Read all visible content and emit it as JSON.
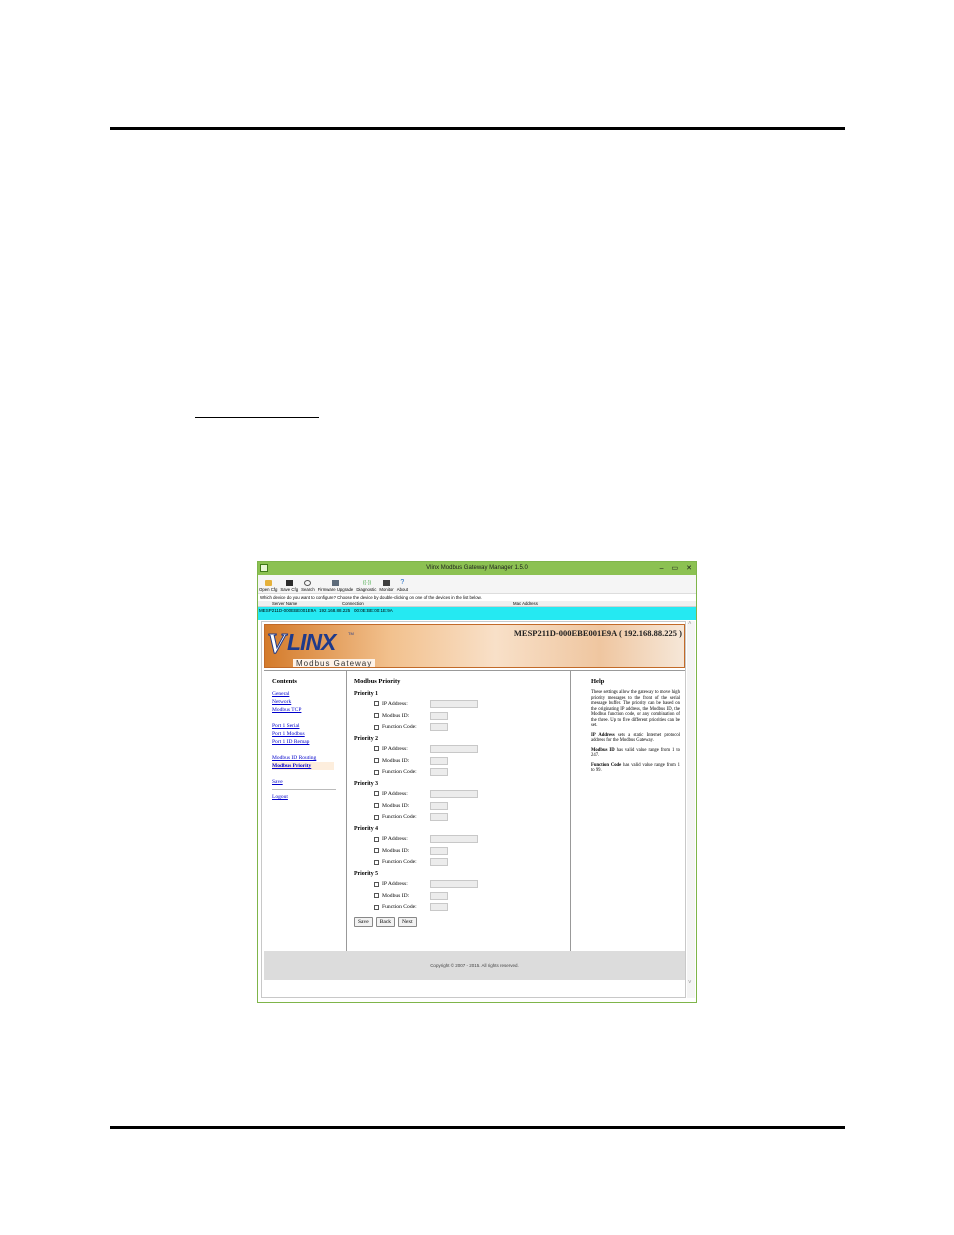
{
  "window": {
    "title": "Vlinx Modbus Gateway Manager 1.5.0",
    "controls": [
      "–",
      "▭",
      "✕"
    ],
    "toolbar": [
      "Open Cfg",
      "Save Cfg",
      "Search",
      "Firmware Upgrade",
      "Diagnostic",
      "Monitor",
      "About"
    ],
    "prompt": "Which device do you want to configure? Choose the device by double-clicking on one of the devices in the list below.",
    "device_columns": [
      "Server Name",
      "Connection",
      "Mac Address"
    ],
    "device_row": {
      "server_name": "MESP211D-000EBE001E9A",
      "connection": "192.168.88.225",
      "mac": "00:0E:BE:00:1E:9A"
    }
  },
  "web": {
    "banner": {
      "logo_v": "V",
      "logo_linx": "LINX",
      "logo_tm": "TM",
      "tagline": "Modbus Gateway",
      "device_id": "MESP211D-000EBE001E9A ( 192.168.88.225 )"
    },
    "contents": {
      "heading": "Contents",
      "links": {
        "general": "General",
        "network": "Network",
        "modbus_tcp": "Modbus TCP",
        "port1_serial": "Port 1 Serial",
        "port1_modbus": "Port 1 Modbus",
        "port1_id_remap": "Port 1 ID Remap",
        "modbus_id_routing": "Modbus ID Routing",
        "modbus_priority": "Modbus Priority",
        "save": "Save",
        "logout": "Logout"
      }
    },
    "priority": {
      "heading": "Modbus Priority",
      "groups": [
        "Priority 1",
        "Priority 2",
        "Priority 3",
        "Priority 4",
        "Priority 5"
      ],
      "fields": {
        "ip": "IP Address:",
        "modbus_id": "Modbus ID:",
        "function_code": "Function Code:"
      },
      "buttons": {
        "save": "Save",
        "back": "Back",
        "next": "Next"
      }
    },
    "help": {
      "heading": "Help",
      "intro": "These settings allow the gateway to move high priority messages to the front of the serial message buffer. The priority can be based on the originating IP address, the Modbus ID, the Modbus function code, or any combination of the three. Up to five different priorities can be set.",
      "ip_term": "IP Address",
      "ip_text": " sets a static Internet protocol address for the Modbus Gateway.",
      "id_term": "Modbus ID",
      "id_text": " has valid value range from 1 to 247.",
      "fc_term": "Function Code",
      "fc_text": " has valid value range from 1 to 99."
    },
    "footer": "Copyright © 2007 - 2015. All rights reserved."
  }
}
